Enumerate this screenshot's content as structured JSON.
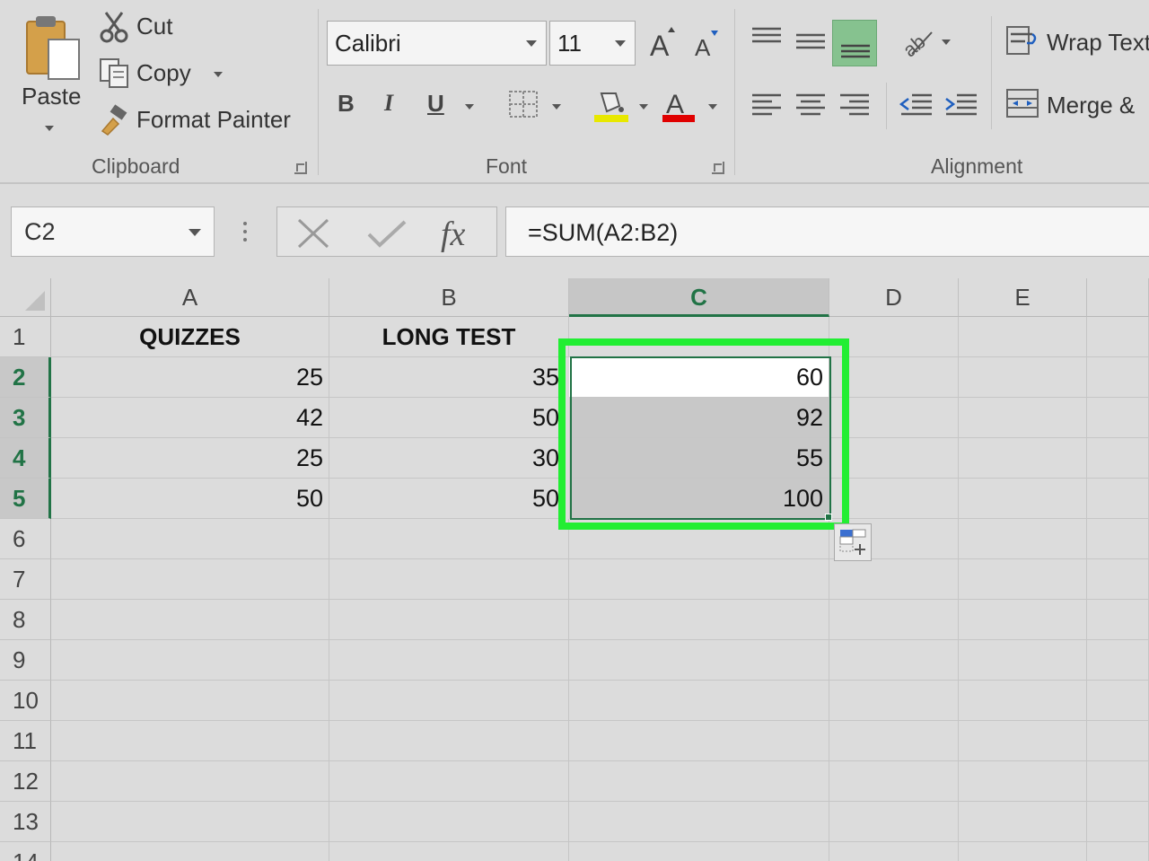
{
  "ribbon": {
    "clipboard": {
      "paste_label": "Paste",
      "cut_label": "Cut",
      "copy_label": "Copy",
      "format_painter_label": "Format Painter",
      "group_label": "Clipboard"
    },
    "font": {
      "font_name": "Calibri",
      "font_size": "11",
      "bold_label": "B",
      "italic_label": "I",
      "underline_label": "U",
      "group_label": "Font",
      "fill_color": "#e8e800",
      "font_color": "#e00000"
    },
    "alignment": {
      "wrap_text_label": "Wrap Text",
      "merge_label": "Merge &",
      "group_label": "Alignment"
    }
  },
  "formula_bar": {
    "name_box": "C2",
    "formula": "=SUM(A2:B2)"
  },
  "grid": {
    "columns": [
      "A",
      "B",
      "C",
      "D",
      "E"
    ],
    "selected_column": "C",
    "rows": [
      "1",
      "2",
      "3",
      "4",
      "5",
      "6",
      "7",
      "8",
      "9",
      "10",
      "11",
      "12",
      "13",
      "14"
    ],
    "selected_rows": [
      "2",
      "3",
      "4",
      "5"
    ],
    "cells": {
      "A1": "QUIZZES",
      "B1": "LONG TEST",
      "A2": "25",
      "B2": "35",
      "C2": "60",
      "A3": "42",
      "B3": "50",
      "C3": "92",
      "A4": "25",
      "B4": "30",
      "C4": "55",
      "A5": "50",
      "B5": "50",
      "C5": "100"
    }
  },
  "colors": {
    "accent": "#217346",
    "highlight": "#22ee33"
  }
}
